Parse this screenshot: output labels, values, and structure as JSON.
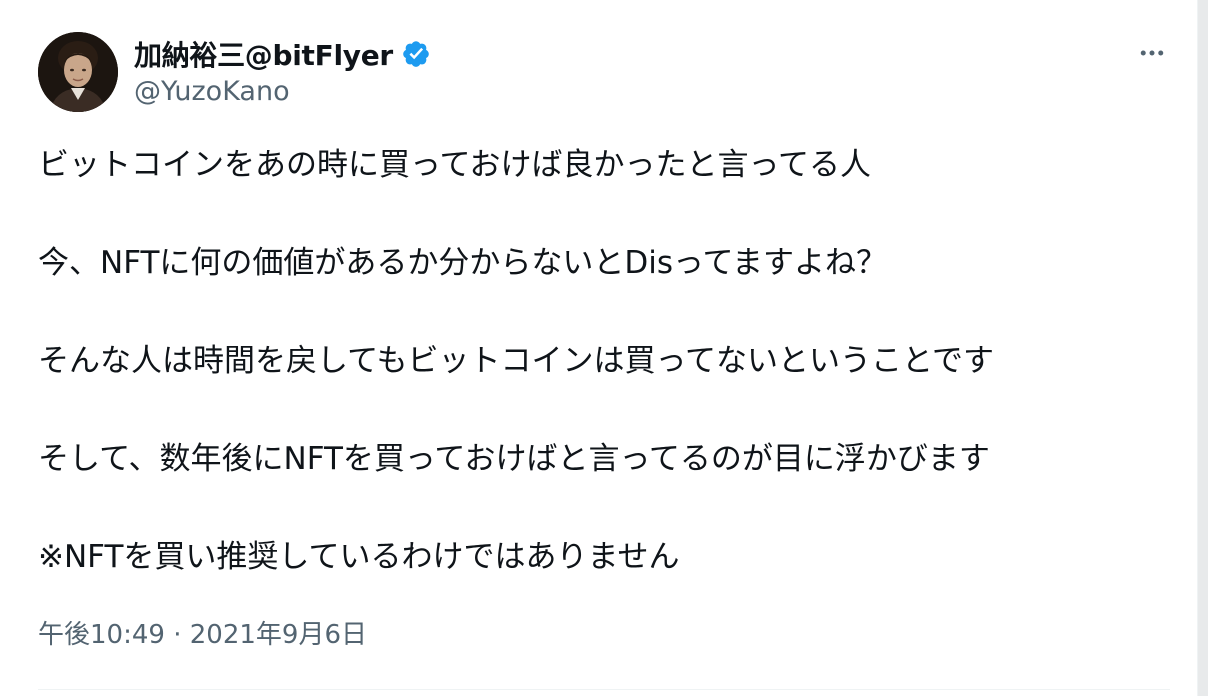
{
  "author": {
    "display_name": "加納裕三@bitFlyer",
    "handle": "@YuzoKano",
    "verified_icon": "verified-badge-icon",
    "verified_color": "#1d9bf0"
  },
  "tweet": {
    "paragraphs": [
      "ビットコインをあの時に買っておけば良かったと言ってる人",
      "今、NFTに何の価値があるか分からないとDisってますよね？",
      "そんな人は時間を戻してもビットコインは買ってないということです",
      "そして、数年後にNFTを買っておけばと言ってるのが目に浮かびます",
      "※NFTを買い推奨しているわけではありません"
    ],
    "time": "午後10:49",
    "separator": " · ",
    "date": "2021年9月6日"
  },
  "actions": {
    "more_icon": "more-horizontal-icon"
  },
  "colors": {
    "text": "#0f1419",
    "secondary": "#536471",
    "divider": "#eff3f4"
  }
}
